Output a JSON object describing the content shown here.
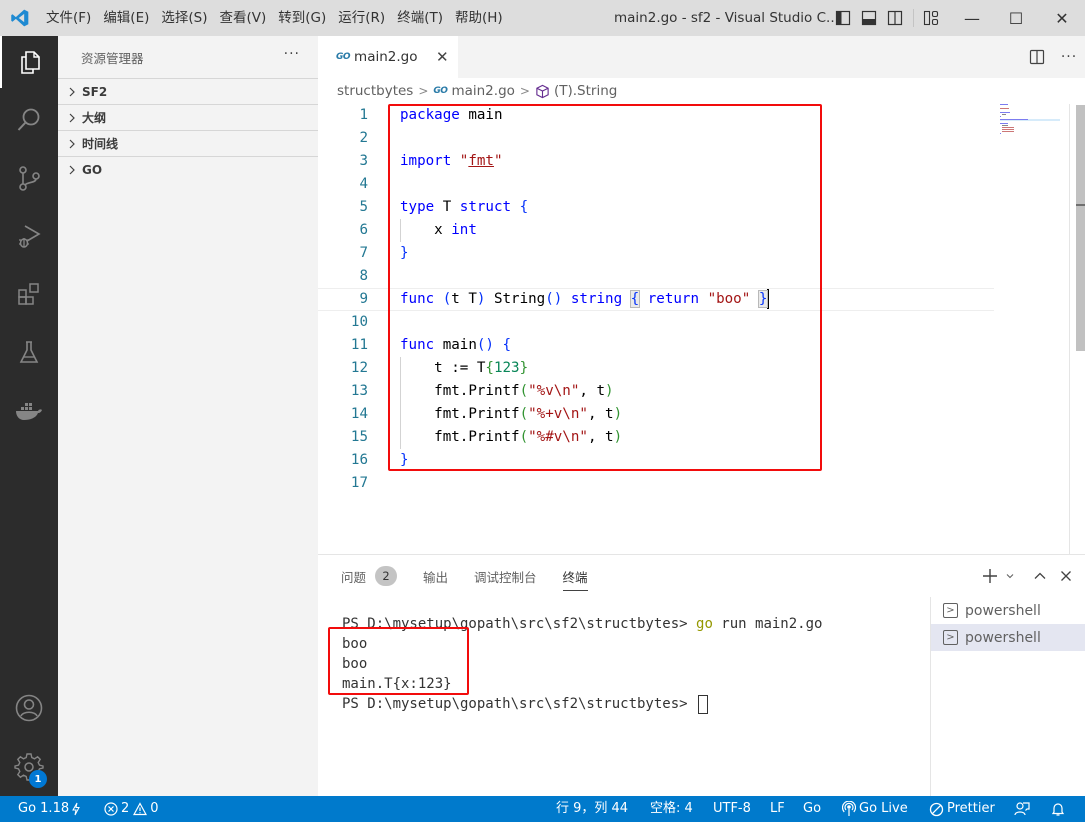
{
  "titlebar": {
    "menu": [
      "文件(F)",
      "编辑(E)",
      "选择(S)",
      "查看(V)",
      "转到(G)",
      "运行(R)",
      "终端(T)",
      "帮助(H)"
    ],
    "window_title": "main2.go - sf2 - Visual Studio C...",
    "controls": {
      "minimize": "—",
      "maximize": "☐",
      "close": "✕"
    }
  },
  "activitybar": {
    "items": [
      "explorer-icon",
      "search-icon",
      "source-control-icon",
      "run-debug-icon",
      "extensions-icon",
      "testing-icon",
      "docker-icon"
    ],
    "bottom": [
      "accounts-icon",
      "manage-gear-icon"
    ],
    "settings_badge": "1"
  },
  "sidebar": {
    "title": "资源管理器",
    "more": "···",
    "sections": [
      "SF2",
      "大纲",
      "时间线",
      "GO"
    ]
  },
  "editor": {
    "tab": {
      "filename": "main2.go",
      "icon_text": "GO",
      "close": "✕"
    },
    "breadcrumb": {
      "folder": "structbytes",
      "file": "main2.go",
      "symbol": "(T).String"
    },
    "line_numbers": [
      "1",
      "2",
      "3",
      "4",
      "5",
      "6",
      "7",
      "8",
      "9",
      "10",
      "11",
      "12",
      "13",
      "14",
      "15",
      "16",
      "17"
    ],
    "code": {
      "l1": {
        "kw": "package",
        "rest": " main"
      },
      "l3": {
        "kw": "import",
        "q1": " \"",
        "pkg": "fmt",
        "q2": "\""
      },
      "l5": {
        "kw1": "type",
        "mid": " T ",
        "kw2": "struct",
        "brace": " {"
      },
      "l6": {
        "indent": "    x ",
        "kw": "int"
      },
      "l7": {
        "brace": "}"
      },
      "l9": {
        "kw1": "func",
        "p1": " (",
        "recv": "t T",
        "p2": ")",
        "name": " String",
        "p3": "()",
        "sp": " ",
        "kw2": "string",
        "sp2": " ",
        "b1": "{",
        "sp3": " ",
        "kw3": "return",
        "sp4": " ",
        "str": "\"boo\"",
        "sp5": " ",
        "b2": "}"
      },
      "l11": {
        "kw": "func",
        "name": " main",
        "p": "()",
        "brace": " {"
      },
      "l12": {
        "pre": "    t := T",
        "b1": "{",
        "num": "123",
        "b2": "}"
      },
      "l13": {
        "pre": "    fmt.Printf",
        "p1": "(",
        "str": "\"%v\\n\"",
        "mid": ", t",
        "p2": ")"
      },
      "l14": {
        "pre": "    fmt.Printf",
        "p1": "(",
        "str": "\"%+v\\n\"",
        "mid": ", t",
        "p2": ")"
      },
      "l15": {
        "pre": "    fmt.Printf",
        "p1": "(",
        "str": "\"%#v\\n\"",
        "mid": ", t",
        "p2": ")"
      },
      "l16": {
        "brace": "}"
      }
    }
  },
  "panel": {
    "tabs": [
      {
        "label": "问题",
        "badge": "2"
      },
      {
        "label": "输出"
      },
      {
        "label": "调试控制台"
      },
      {
        "label": "终端",
        "active": true
      }
    ],
    "terminal_lines": {
      "prompt1": "PS D:\\mysetup\\gopath\\src\\sf2\\structbytes> ",
      "cmd_go": "go",
      "cmd_rest": " run main2.go",
      "out1": "boo",
      "out2": "boo",
      "out3": "main.T{x:123}",
      "prompt2": "PS D:\\mysetup\\gopath\\src\\sf2\\structbytes> "
    },
    "terminals": [
      "powershell",
      "powershell"
    ],
    "selected_terminal": 1
  },
  "statusbar": {
    "go_version": "Go 1.18",
    "errors": "2",
    "warnings": "0",
    "cursor_position": "行 9，列 44",
    "indent": "空格: 4",
    "encoding": "UTF-8",
    "eol": "LF",
    "language": "Go",
    "go_live": "Go Live",
    "prettier": "Prettier"
  },
  "colors": {
    "statusbar": "#007acc",
    "activitybar": "#2c2c2c",
    "highlight_box": "#f20c0c",
    "keyword": "#0000ff",
    "string": "#a31515",
    "number": "#098658"
  }
}
